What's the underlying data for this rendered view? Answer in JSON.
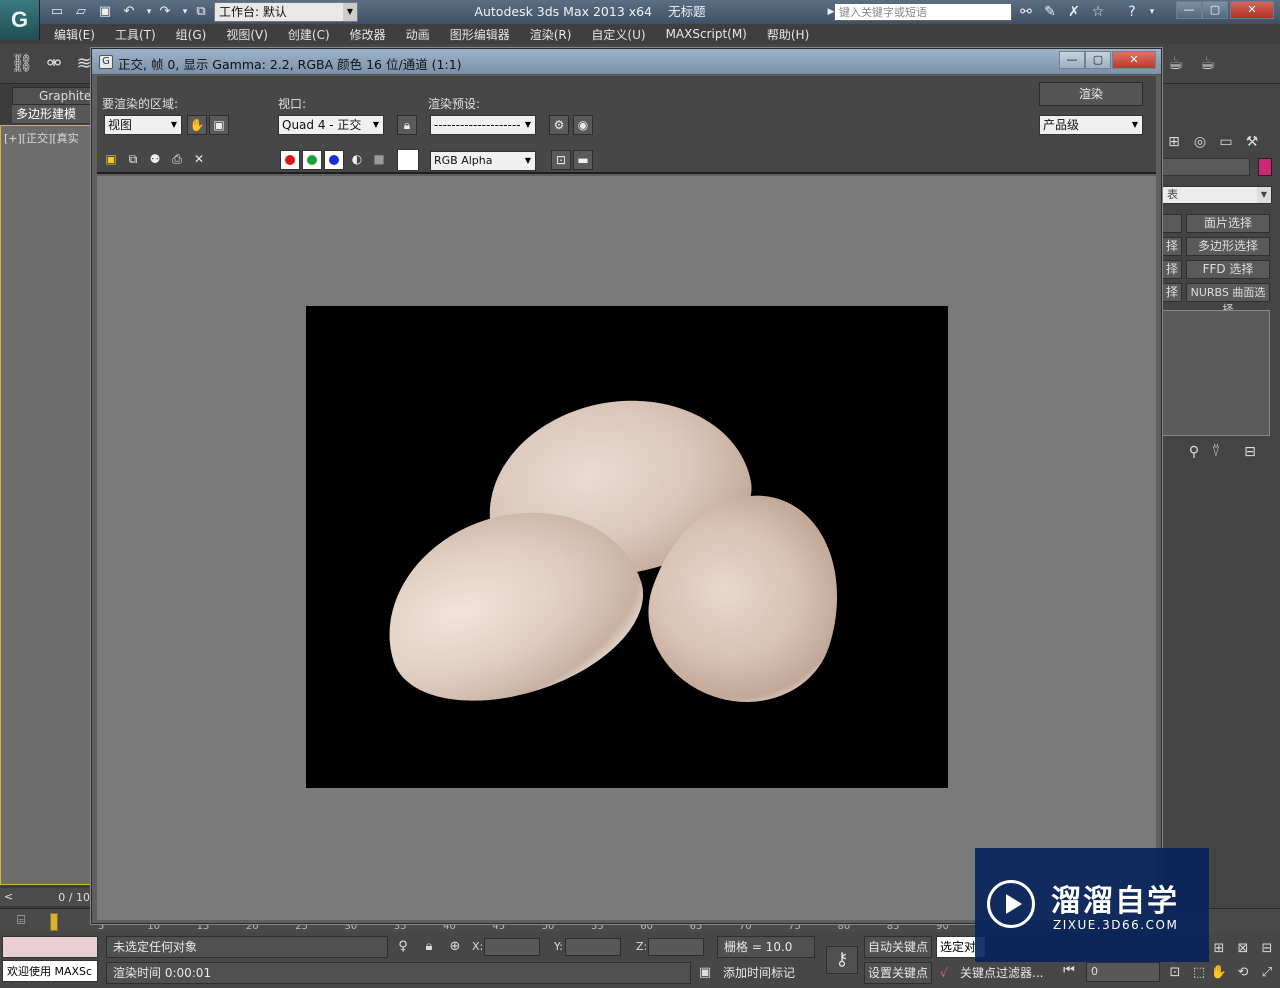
{
  "app": {
    "logo_glyph": "G",
    "workspace": "工作台: 默认",
    "title_product": "Autodesk 3ds Max  2013 x64",
    "title_file": "无标题",
    "search_placeholder": "键入关键字或短语"
  },
  "menu": [
    "编辑(E)",
    "工具(T)",
    "组(G)",
    "视图(V)",
    "创建(C)",
    "修改器",
    "动画",
    "图形编辑器",
    "渲染(R)",
    "自定义(U)",
    "MAXScript(M)",
    "帮助(H)"
  ],
  "left": {
    "ribbon_tab": "Graphite",
    "poly_tab": "多边形建模",
    "viewport_label": "[+][正交][真实",
    "timeline_count": "0 / 10"
  },
  "render_window": {
    "title": "正交, 帧 0, 显示 Gamma: 2.2, RGBA 颜色 16 位/通道 (1:1)",
    "area_label": "要渲染的区域:",
    "area_value": "视图",
    "viewport_label": "视口:",
    "viewport_value": "Quad 4 - 正交",
    "preset_label": "渲染预设:",
    "preset_value": "--------------------",
    "render_button": "渲染",
    "quality_value": "产品级",
    "channel_value": "RGB Alpha",
    "channel_colors": {
      "red": "#e0141b",
      "green": "#19a03a",
      "blue": "#1d2fd6"
    }
  },
  "command_panel": {
    "modifier_dropdown": "表",
    "buttons": [
      "面片选择",
      "多边形选择",
      "FFD 选择",
      "NURBS 曲面选择"
    ],
    "buttons_left": [
      "",
      "择",
      "择",
      "择"
    ],
    "swatch_color": "#c92a78"
  },
  "trackbar": {
    "ticks": [
      "5",
      "10",
      "15",
      "20",
      "25",
      "30",
      "35",
      "40",
      "45",
      "50",
      "55",
      "60",
      "65",
      "70",
      "75",
      "80",
      "85",
      "90"
    ]
  },
  "status": {
    "maxscript_welcome": "欢迎使用 MAXSc",
    "selection": "未选定任何对象",
    "render_time": "渲染时间  0:00:01",
    "x_label": "X:",
    "y_label": "Y:",
    "z_label": "Z:",
    "grid": "栅格 = 10.0",
    "add_time_tag": "添加时间标记",
    "auto_key": "自动关键点",
    "set_key": "设置关键点",
    "selection_set": "选定对",
    "key_filters": "关键点过滤器...",
    "frame": "0"
  },
  "watermark": {
    "name": "溜溜自学",
    "url": "ZIXUE.3D66.COM"
  }
}
